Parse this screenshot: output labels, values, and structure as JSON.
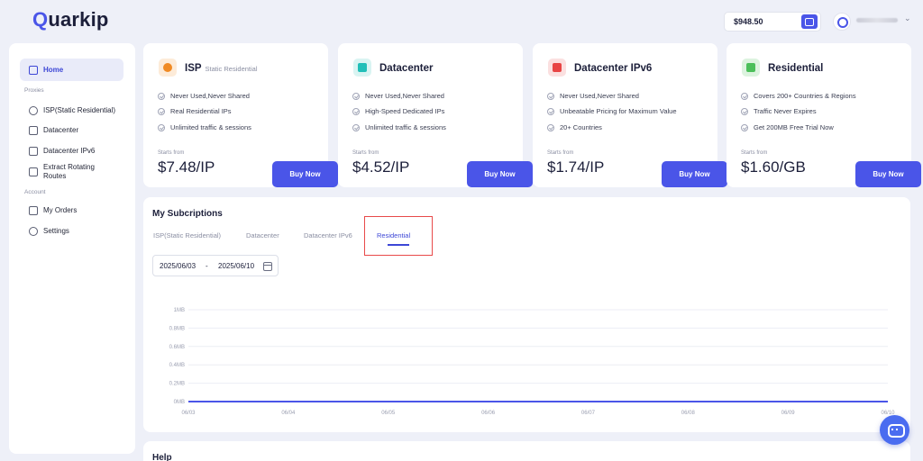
{
  "brand": {
    "logo_text_first": "Q",
    "logo_text_rest": "uarkip"
  },
  "header": {
    "balance": "$948.50",
    "wallet_icon": "wallet-icon",
    "avatar_icon": "avatar-icon",
    "chevron": "⌄"
  },
  "sidebar": {
    "items": [
      {
        "label": "Home",
        "icon": "home-icon",
        "active": true
      },
      {
        "label": "ISP(Static Residential)",
        "icon": "location-pin-icon"
      },
      {
        "label": "Datacenter",
        "icon": "server-icon"
      },
      {
        "label": "Datacenter IPv6",
        "icon": "monitor-icon"
      },
      {
        "label": "Extract Rotating Routes",
        "icon": "database-icon"
      },
      {
        "label": "My Orders",
        "icon": "orders-icon"
      },
      {
        "label": "Settings",
        "icon": "gear-icon"
      }
    ],
    "sections": {
      "proxies": "Proxies",
      "account": "Account"
    }
  },
  "products": [
    {
      "title": "ISP",
      "subtitle": "Static Residential",
      "features": [
        "Never Used,Never Shared",
        "Real Residential IPs",
        "Unlimited traffic & sessions"
      ],
      "starts_label": "Starts from",
      "price": "$7.48/IP",
      "button": "Buy Now",
      "icon": "location-pin-icon",
      "accent": "#f08a24",
      "accent_bg": "#fdebd8"
    },
    {
      "title": "Datacenter",
      "subtitle": "",
      "features": [
        "Never Used,Never Shared",
        "High-Speed Dedicated IPs",
        "Unlimited traffic & sessions"
      ],
      "starts_label": "Starts from",
      "price": "$4.52/IP",
      "button": "Buy Now",
      "icon": "server-icon",
      "accent": "#21bfb8",
      "accent_bg": "#d9f4f2"
    },
    {
      "title": "Datacenter IPv6",
      "subtitle": "",
      "features": [
        "Never Used,Never Shared",
        "Unbeatable Pricing for Maximum Value",
        "20+ Countries"
      ],
      "starts_label": "Starts from",
      "price": "$1.74/IP",
      "button": "Buy Now",
      "icon": "ipv6-icon",
      "accent": "#e84545",
      "accent_bg": "#fbe0e0"
    },
    {
      "title": "Residential",
      "subtitle": "",
      "features": [
        "Covers 200+ Countries & Regions",
        "Traffic Never Expires",
        "Get 200MB Free Trial Now"
      ],
      "starts_label": "Starts from",
      "price": "$1.60/GB",
      "button": "Buy Now",
      "icon": "residential-icon",
      "accent": "#4bbf5a",
      "accent_bg": "#dcf3df"
    }
  ],
  "subscriptions": {
    "title": "My Subcriptions",
    "tabs": [
      "ISP(Static Residential)",
      "Datacenter",
      "Datacenter IPv6",
      "Residential"
    ],
    "active_tab": "Residential",
    "date_start": "2025/06/03",
    "date_sep": "-",
    "date_end": "2025/06/10",
    "calendar_icon": "calendar-icon"
  },
  "chart_data": {
    "type": "line",
    "x": [
      "06/03",
      "06/04",
      "06/05",
      "06/06",
      "06/07",
      "06/08",
      "06/09",
      "06/10"
    ],
    "y_ticks": [
      "0MB",
      "0.2MB",
      "0.4MB",
      "0.6MB",
      "0.8MB",
      "1MB"
    ],
    "series": [
      {
        "values": [
          0,
          0,
          0,
          0,
          0,
          0,
          0,
          0
        ],
        "color": "#4a55e8"
      }
    ],
    "ylim": [
      0,
      1
    ],
    "grid": true
  },
  "help": {
    "title": "Help"
  },
  "chat": {
    "icon": "chat-icon"
  }
}
